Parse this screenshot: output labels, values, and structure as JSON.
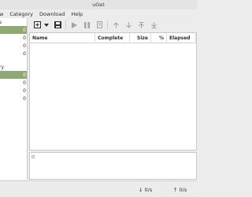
{
  "window": {
    "title": "uGet"
  },
  "menu": [
    "w",
    "Category",
    "Download",
    "Help"
  ],
  "sidebar": {
    "status_header": "s",
    "status_rows": [
      {
        "label": "",
        "count": "0",
        "selected": true
      },
      {
        "label": "",
        "count": "0",
        "selected": false
      },
      {
        "label": "",
        "count": "0",
        "selected": false
      },
      {
        "label": "",
        "count": "0",
        "selected": false
      }
    ],
    "category_header": "ry",
    "category_rows": [
      {
        "label": "",
        "count": "0",
        "selected": true
      },
      {
        "label": "",
        "count": "0",
        "selected": false
      },
      {
        "label": "",
        "count": "0",
        "selected": false
      },
      {
        "label": "",
        "count": "0",
        "selected": false
      }
    ]
  },
  "toolbar": {
    "icons": [
      "new-download-icon",
      "dropdown-arrow-icon",
      "save-icon",
      "start-icon",
      "pause-icon",
      "properties-icon",
      "move-up-icon",
      "move-down-icon",
      "move-top-icon",
      "move-bottom-icon"
    ]
  },
  "table": {
    "columns": [
      "Name",
      "Complete",
      "Size",
      "%",
      "Elapsed"
    ]
  },
  "status": {
    "download_speed": "0/s",
    "upload_speed": "0/s"
  }
}
